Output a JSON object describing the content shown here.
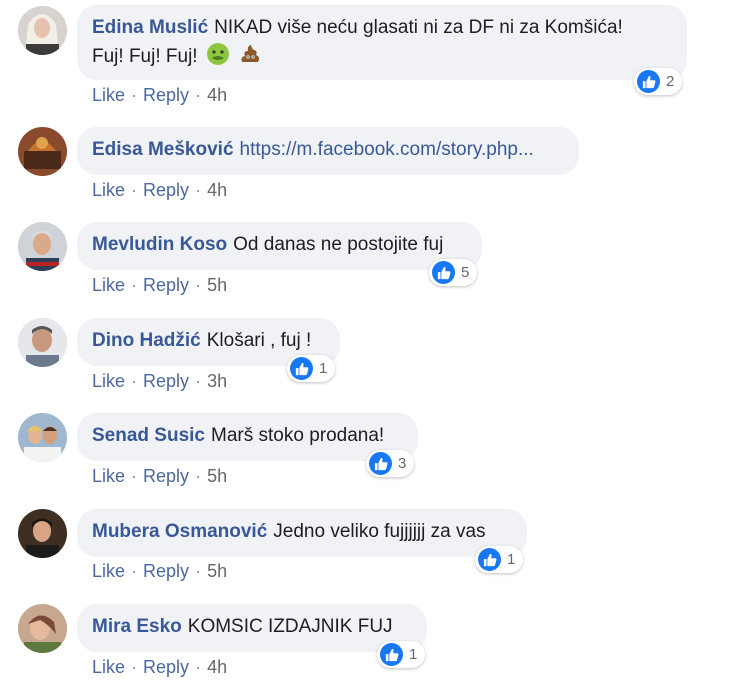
{
  "comments": [
    {
      "author": "Edina Muslić",
      "text": "NIKAD više neću glasati ni za DF ni za Komšića!",
      "text2": "Fuj! Fuj! Fuj!",
      "emojis": [
        "nauseated-face-icon",
        "poop-icon"
      ],
      "likes": "2",
      "like": "Like",
      "reply": "Reply",
      "time": "4h"
    },
    {
      "author": "Edisa Mešković",
      "text": "https://m.facebook.com/story.php...",
      "like": "Like",
      "reply": "Reply",
      "time": "4h"
    },
    {
      "author": "Mevludin Koso",
      "text": "Od danas ne postojite fuj",
      "likes": "5",
      "like": "Like",
      "reply": "Reply",
      "time": "5h"
    },
    {
      "author": "Dino Hadžić",
      "text": "Klošari , fuj !",
      "likes": "1",
      "like": "Like",
      "reply": "Reply",
      "time": "3h"
    },
    {
      "author": "Senad Susic",
      "text": "Marš stoko prodana!",
      "likes": "3",
      "like": "Like",
      "reply": "Reply",
      "time": "5h"
    },
    {
      "author": "Mubera Osmanović",
      "text": "Jedno veliko fujjjjjj za vas",
      "likes": "1",
      "like": "Like",
      "reply": "Reply",
      "time": "5h"
    },
    {
      "author": "Mira Esko",
      "text": "KOMSIC IZDAJNIK FUJ",
      "likes": "1",
      "like": "Like",
      "reply": "Reply",
      "time": "4h"
    }
  ],
  "colors": {
    "author": "#385898",
    "bubble": "#f0f2f5",
    "like_blue": "#1877f2",
    "meta": "#65676b"
  }
}
